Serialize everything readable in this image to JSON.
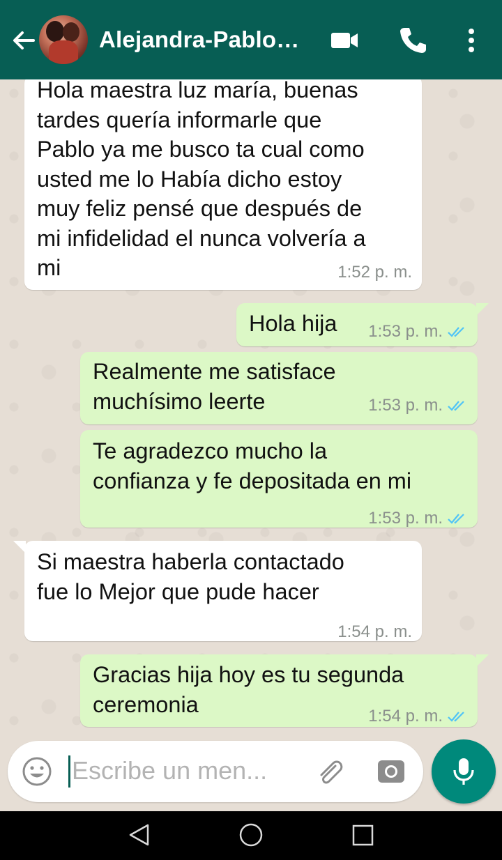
{
  "header": {
    "contact_name": "Alejandra-Pablo…",
    "colors": {
      "bar": "#075e54",
      "icon": "#ffffff"
    },
    "icons": [
      "back-arrow-icon",
      "video-call-icon",
      "phone-icon",
      "more-options-icon"
    ]
  },
  "messages": [
    {
      "direction": "incoming",
      "text": "Hola maestra luz maría, buenas\ntardes quería informarle que\nPablo ya me busco ta cual como\nusted me lo Había dicho estoy\nmuy feliz pensé que después de\nmi infidelidad el nunca volvería a\nmi",
      "time": "1:52 p. m."
    },
    {
      "direction": "outgoing",
      "text": "Hola hija",
      "time": "1:53 p. m.",
      "status": "read"
    },
    {
      "direction": "outgoing",
      "text": "Realmente me satisface\nmuchísimo leerte",
      "time": "1:53 p. m.",
      "status": "read"
    },
    {
      "direction": "outgoing",
      "text": "Te agradezco mucho la\nconfianza y fe depositada en mi",
      "time": "1:53 p. m.",
      "status": "read"
    },
    {
      "direction": "incoming",
      "text": "Si maestra haberla contactado\nfue lo Mejor que pude hacer",
      "time": "1:54 p. m."
    },
    {
      "direction": "outgoing",
      "text": "Gracias hija hoy es tu segunda\nceremonia",
      "time": "1:54 p. m.",
      "status": "read"
    }
  ],
  "composer": {
    "placeholder": "Escribe un men...",
    "icons": [
      "emoji-icon",
      "attach-icon",
      "camera-icon",
      "microphone-icon"
    ],
    "mic_color": "#00897b"
  },
  "colors": {
    "incoming_bubble": "#ffffff",
    "outgoing_bubble": "#dcf8c6",
    "read_ticks": "#4fc3f7",
    "chat_background": "#e6ded5"
  },
  "navbar": {
    "icons": [
      "nav-back-icon",
      "nav-home-icon",
      "nav-recents-icon"
    ]
  }
}
